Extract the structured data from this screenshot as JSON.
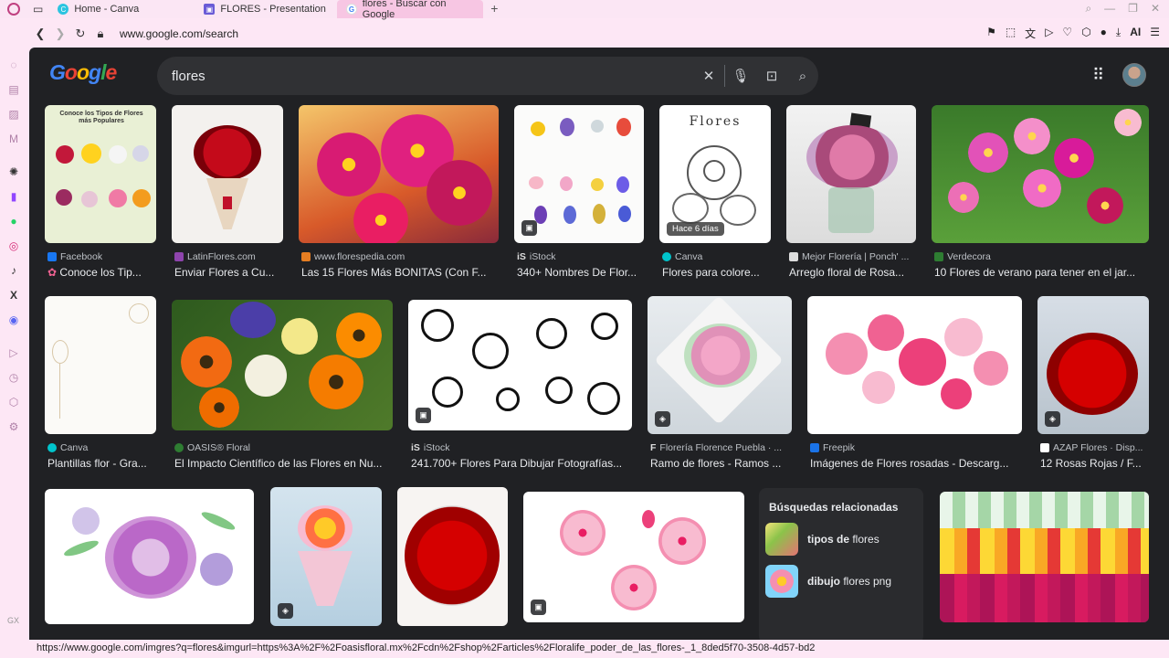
{
  "tabs": [
    {
      "label": "Home - Canva",
      "icon": "canva-icon"
    },
    {
      "label": "FLORES - Presentation",
      "icon": "presentation-icon"
    },
    {
      "label": "flores - Buscar con Google",
      "icon": "google-icon"
    }
  ],
  "address": {
    "url": "www.google.com/search"
  },
  "google": {
    "logo": "Google",
    "query": "flores"
  },
  "results": [
    {
      "source": "Facebook",
      "caption": "Conoce los Tip..."
    },
    {
      "source": "LatinFlores.com",
      "caption": "Enviar Flores a Cu..."
    },
    {
      "source": "www.florespedia.com",
      "caption": "Las 15 Flores Más BONITAS (Con F..."
    },
    {
      "source": "iStock",
      "caption": "340+ Nombres De Flor..."
    },
    {
      "source": "Canva",
      "caption": "Flores para colore...",
      "image_text": "Flores",
      "badge": "Hace 6 días"
    },
    {
      "source": "Mejor Florería | Ponch' ...",
      "caption": "Arreglo floral de Rosa..."
    },
    {
      "source": "Verdecora",
      "caption": "10 Flores de verano para tener en el jar..."
    },
    {
      "source": "Canva",
      "caption": "Plantillas flor - Gra..."
    },
    {
      "source": "OASIS® Floral",
      "caption": "El Impacto Científico de las Flores en Nu..."
    },
    {
      "source": "iStock",
      "caption": "241.700+ Flores Para Dibujar Fotografías..."
    },
    {
      "source": "Florería Florence Puebla · ...",
      "caption": "Ramo de flores - Ramos ..."
    },
    {
      "source": "Freepik",
      "caption": "Imágenes de Flores rosadas - Descarg..."
    },
    {
      "source": "AZAP Flores · Disp...",
      "caption": "12 Rosas Rojas / F..."
    }
  ],
  "related": {
    "title": "Búsquedas relacionadas",
    "items": [
      {
        "bold": "tipos de",
        "rest": " flores"
      },
      {
        "bold": "dibujo",
        "rest": " flores png"
      }
    ]
  },
  "status_url": "https://www.google.com/imgres?q=flores&imgurl=https%3A%2F%2Foasisfloral.mx%2Fcdn%2Fshop%2Farticles%2Floralife_poder_de_las_flores-_1_8ded5f70-3508-4d57-bd28-4289c95387e3_800x.png%3Fv%3D1741807330&imgrefur..."
}
